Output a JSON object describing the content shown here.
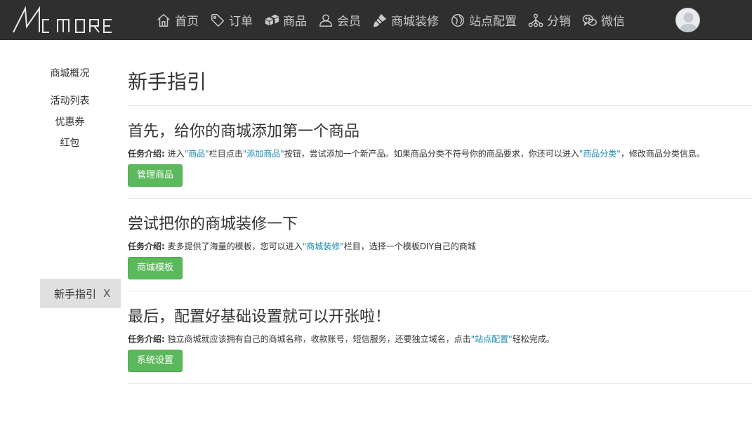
{
  "header": {
    "logo_text": "MC MORE",
    "nav": [
      {
        "label": "首页",
        "icon": "home-icon"
      },
      {
        "label": "订单",
        "icon": "tag-icon"
      },
      {
        "label": "商品",
        "icon": "boxes-icon"
      },
      {
        "label": "会员",
        "icon": "user-icon"
      },
      {
        "label": "商城装修",
        "icon": "brush-icon"
      },
      {
        "label": "站点配置",
        "icon": "globe-icon"
      },
      {
        "label": "分销",
        "icon": "network-icon"
      },
      {
        "label": "微信",
        "icon": "wechat-icon"
      }
    ]
  },
  "sidebar": {
    "items": [
      "商城概况",
      "活动列表",
      "优惠券",
      "红包"
    ],
    "guide_tab": {
      "label": "新手指引",
      "close": "X"
    }
  },
  "main": {
    "title": "新手指引",
    "sections": [
      {
        "title": "首先，给你的商城添加第一个商品",
        "desc_label": "任务介绍:",
        "desc_parts": [
          " 进入",
          "\"商品\"",
          "栏目点击",
          "\"添加商品\"",
          "按钮，尝试添加一个新产品。如果商品分类不符号你的商品要求，你还可以进入",
          "\"商品分类\"",
          "，修改商品分类信息。"
        ],
        "button": "管理商品"
      },
      {
        "title": "尝试把你的商城装修一下",
        "desc_label": "任务介绍:",
        "desc_parts": [
          " 麦多提供了海量的模板，您可以进入",
          "\"商城装修\"",
          "栏目，选择一个模板DIY自己的商城"
        ],
        "button": "商城模板"
      },
      {
        "title": "最后，配置好基础设置就可以开张啦！",
        "desc_label": "任务介绍:",
        "desc_parts": [
          " 独立商城就应该拥有自己的商城名称，收款账号，短信服务，还要独立域名，点击",
          "\"站点配置\"",
          "轻松完成。"
        ],
        "button": "系统设置"
      }
    ]
  },
  "colors": {
    "topbar": "#2f2f2f",
    "button": "#5cb85c",
    "link": "#1a8ab3",
    "guide_tab": "#e0e0e0"
  }
}
